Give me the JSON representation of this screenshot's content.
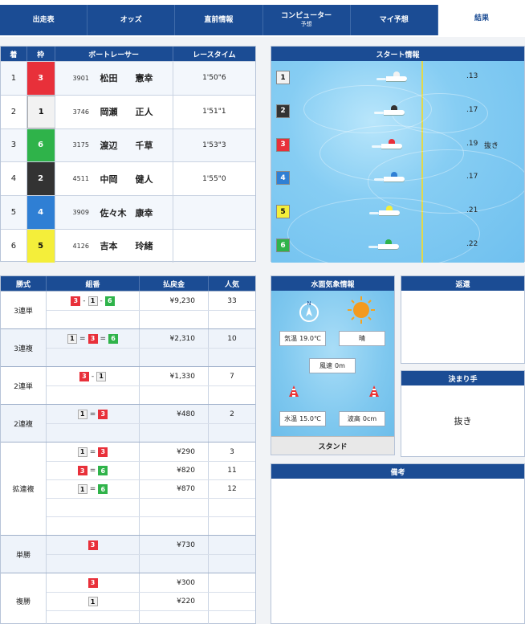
{
  "nav": {
    "tabs": [
      {
        "label": "出走表",
        "sub": ""
      },
      {
        "label": "オッズ",
        "sub": ""
      },
      {
        "label": "直前情報",
        "sub": ""
      },
      {
        "label": "コンピューター",
        "sub": "予想"
      },
      {
        "label": "マイ予想",
        "sub": ""
      },
      {
        "label": "結果",
        "sub": ""
      }
    ],
    "active_index": 5
  },
  "results": {
    "headers": [
      "着",
      "枠",
      "ボートレーサー",
      "レースタイム"
    ],
    "rows": [
      {
        "rank": "1",
        "waku": "3",
        "reg": "3901",
        "name": "松田　　憲幸",
        "time": "1'50\"6"
      },
      {
        "rank": "2",
        "waku": "1",
        "reg": "3746",
        "name": "岡瀬　　正人",
        "time": "1'51\"1"
      },
      {
        "rank": "3",
        "waku": "6",
        "reg": "3175",
        "name": "渡辺　　千草",
        "time": "1'53\"3"
      },
      {
        "rank": "4",
        "waku": "2",
        "reg": "4511",
        "name": "中岡　　健人",
        "time": "1'55\"0"
      },
      {
        "rank": "5",
        "waku": "4",
        "reg": "3909",
        "name": "佐々木　康幸",
        "time": ""
      },
      {
        "rank": "6",
        "waku": "5",
        "reg": "4126",
        "name": "吉本　　玲緒",
        "time": ""
      }
    ]
  },
  "start": {
    "title": "スタート情報",
    "rows": [
      {
        "lane": "1",
        "st": ".13",
        "note": ""
      },
      {
        "lane": "2",
        "st": ".17",
        "note": ""
      },
      {
        "lane": "3",
        "st": ".19",
        "note": "抜き"
      },
      {
        "lane": "4",
        "st": ".17",
        "note": ""
      },
      {
        "lane": "5",
        "st": ".21",
        "note": ""
      },
      {
        "lane": "6",
        "st": ".22",
        "note": ""
      }
    ]
  },
  "payout": {
    "headers": [
      "勝式",
      "組番",
      "払戻金",
      "人気"
    ],
    "groups": [
      {
        "type": "3連単",
        "lines": [
          {
            "combo": [
              "3",
              "1",
              "6"
            ],
            "sep": "-",
            "amount": "¥9,230",
            "pop": "33"
          },
          {}
        ]
      },
      {
        "type": "3連複",
        "lines": [
          {
            "combo": [
              "1",
              "3",
              "6"
            ],
            "sep": "=",
            "amount": "¥2,310",
            "pop": "10"
          },
          {}
        ]
      },
      {
        "type": "2連単",
        "lines": [
          {
            "combo": [
              "3",
              "1"
            ],
            "sep": "-",
            "amount": "¥1,330",
            "pop": "7"
          },
          {}
        ]
      },
      {
        "type": "2連複",
        "lines": [
          {
            "combo": [
              "1",
              "3"
            ],
            "sep": "=",
            "amount": "¥480",
            "pop": "2"
          },
          {}
        ]
      },
      {
        "type": "拡連複",
        "lines": [
          {
            "combo": [
              "1",
              "3"
            ],
            "sep": "=",
            "amount": "¥290",
            "pop": "3"
          },
          {
            "combo": [
              "3",
              "6"
            ],
            "sep": "=",
            "amount": "¥820",
            "pop": "11"
          },
          {
            "combo": [
              "1",
              "6"
            ],
            "sep": "=",
            "amount": "¥870",
            "pop": "12"
          },
          {},
          {}
        ]
      },
      {
        "type": "単勝",
        "lines": [
          {
            "combo": [
              "3"
            ],
            "sep": "",
            "amount": "¥730",
            "pop": ""
          },
          {}
        ]
      },
      {
        "type": "複勝",
        "lines": [
          {
            "combo": [
              "3"
            ],
            "sep": "",
            "amount": "¥300",
            "pop": ""
          },
          {
            "combo": [
              "1"
            ],
            "sep": "",
            "amount": "¥220",
            "pop": ""
          },
          {}
        ]
      }
    ]
  },
  "weather": {
    "title": "水面気象情報",
    "temp_label": "気温",
    "temp": "19.0℃",
    "sky": "晴",
    "wind_label": "風速",
    "wind": "0m",
    "water_label": "水温",
    "water": "15.0℃",
    "wave_label": "波高",
    "wave": "0cm",
    "stand": "スタンド",
    "icons": {
      "wind_direction": "compass-arrow-icon",
      "weather": "sun-icon"
    }
  },
  "henkan": {
    "title": "返還"
  },
  "kimarite": {
    "title": "決まり手",
    "value": "抜き"
  },
  "biko": {
    "title": "備考"
  },
  "colors": {
    "nav": "#1b4c94",
    "lane1": "#f2f2f2",
    "lane2": "#333333",
    "lane3": "#e8303a",
    "lane4": "#2f7fd4",
    "lane5": "#f4ee3a",
    "lane6": "#2fb34a"
  }
}
